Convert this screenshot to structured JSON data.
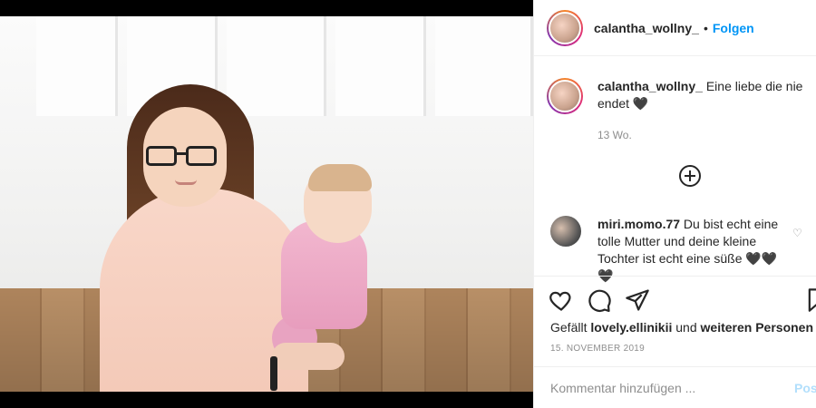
{
  "post": {
    "username": "calantha_wollny_",
    "header_separator": "•",
    "follow_label": "Folgen",
    "caption": "Eine liebe die nie endet 🖤",
    "time_ago": "13 Wo."
  },
  "comments": [
    {
      "username": "miri.momo.77",
      "text": "Du bist echt eine tolle Mutter und deine kleine Tochter ist echt eine süße 🖤🖤🖤"
    }
  ],
  "actions": {
    "likes_prefix": "Gefällt",
    "likes_user": "lovely.ellinikii",
    "likes_connector": "und",
    "likes_suffix": "weiteren Personen",
    "date": "15. NOVEMBER 2019"
  },
  "comment_box": {
    "placeholder": "Kommentar hinzufügen ...",
    "post_label": "Posten"
  },
  "icons": [
    "heart-icon",
    "comment-icon",
    "share-icon",
    "bookmark-icon",
    "add-comments-icon",
    "small-heart-icon"
  ]
}
